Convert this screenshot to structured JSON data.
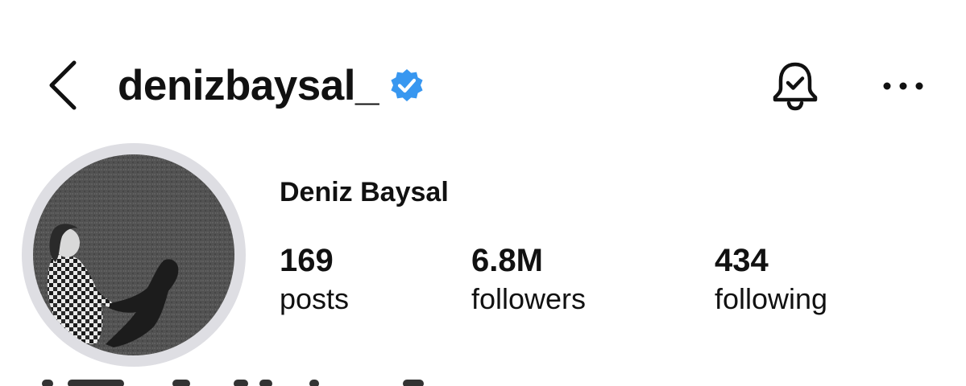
{
  "header": {
    "back_icon": "chevron-left-icon",
    "username": "denizbaysal_",
    "verified_icon": "verified-badge-icon",
    "verified_color": "#3897f0",
    "notifications_icon": "bell-check-icon",
    "more_icon": "more-horizontal-icon"
  },
  "profile": {
    "avatar": "profile-photo",
    "display_name": "Deniz Baysal",
    "stats": [
      {
        "value": "169",
        "label": "posts"
      },
      {
        "value": "6.8M",
        "label": "followers"
      },
      {
        "value": "434",
        "label": "following"
      }
    ]
  },
  "colors": {
    "text": "#111111",
    "background": "#ffffff",
    "avatar_ring": "#dedee3"
  }
}
